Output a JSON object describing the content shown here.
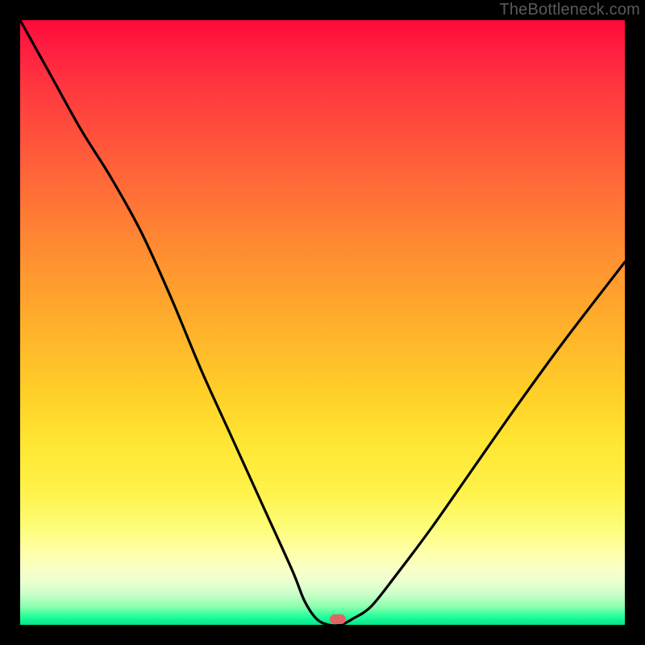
{
  "attribution": "TheBottleneck.com",
  "colors": {
    "frame": "#000000",
    "curve": "#000000",
    "marker": "#e06666",
    "gradient_top": "#ff0a3a",
    "gradient_bottom": "#00e68c"
  },
  "marker": {
    "x_pct": 52.5,
    "y_pct": 99.0
  },
  "chart_data": {
    "type": "line",
    "title": "",
    "xlabel": "",
    "ylabel": "",
    "xlim": [
      0,
      100
    ],
    "ylim": [
      0,
      100
    ],
    "grid": false,
    "legend": false,
    "series": [
      {
        "name": "bottleneck-curve",
        "x": [
          0,
          5,
          10,
          15,
          20,
          25,
          30,
          35,
          40,
          45,
          47,
          49,
          51,
          53,
          55,
          58,
          62,
          68,
          75,
          82,
          90,
          100
        ],
        "y": [
          100,
          91,
          82,
          74,
          65,
          54,
          42,
          31,
          20,
          9,
          4,
          1,
          0,
          0,
          1,
          3,
          8,
          16,
          26,
          36,
          47,
          60
        ]
      }
    ],
    "annotations": [
      {
        "type": "marker",
        "x": 52.5,
        "y": 1.0,
        "label": ""
      }
    ]
  }
}
